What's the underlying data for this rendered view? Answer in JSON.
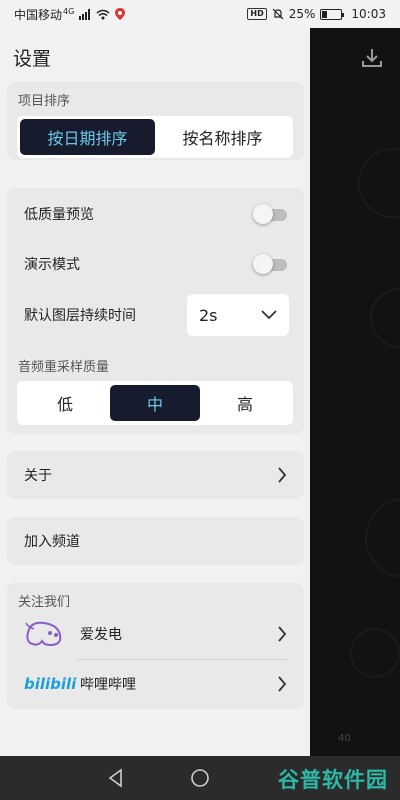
{
  "status_bar": {
    "carrier": "中国移动",
    "network": "4G",
    "battery_text": "25%",
    "battery_level": 0.25,
    "time": "10:03",
    "icons": [
      "signal-icon",
      "wifi-icon",
      "location-icon",
      "hd-icon",
      "mute-bell-icon",
      "battery-icon"
    ]
  },
  "drawer": {
    "title": "设置",
    "sort": {
      "label": "项目排序",
      "options": [
        "按日期排序",
        "按名称排序"
      ],
      "selected": "按日期排序"
    },
    "low_quality_preview": {
      "label": "低质量预览",
      "on": false
    },
    "demo_mode": {
      "label": "演示模式",
      "on": false
    },
    "default_layer_duration": {
      "label": "默认图层持续时间",
      "value": "2s"
    },
    "audio_resample": {
      "label": "音频重采样质量",
      "options": [
        "低",
        "中",
        "高"
      ],
      "selected": "中"
    },
    "about": {
      "label": "关于"
    },
    "join_channel": {
      "label": "加入频道"
    },
    "follow_us": {
      "label": "关注我们",
      "items": [
        {
          "label": "爱发电",
          "icon": "afdian-logo"
        },
        {
          "label": "哔哩哔哩",
          "icon": "bilibili-logo",
          "logo_text": "bilibili"
        }
      ]
    }
  },
  "background": {
    "label": "40"
  },
  "watermark": "谷普软件园",
  "colors": {
    "accent_dark": "#161b2e",
    "accent_text": "#6fc7e8",
    "watermark": "#2db8a6"
  }
}
